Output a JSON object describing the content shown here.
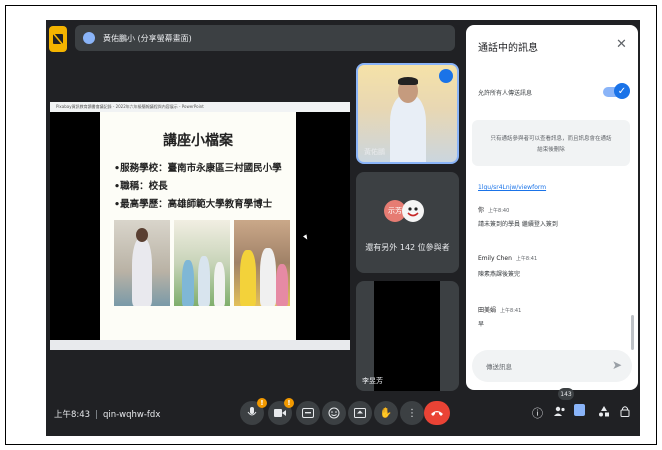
{
  "header": {
    "presenting_text": "黃佑鵬小 (分享螢幕畫面)"
  },
  "shared_screen": {
    "window_title": "Pixabay資訊教育讀書會議記錄 - 2022年六年級簡報議程與內容展示 - PowerPoint",
    "slide": {
      "title": "講座小檔案",
      "lines": [
        "•服務學校：臺南市永康區三村國民小學",
        "•職稱：校長",
        "•最高學歷：高雄師範大學教育學博士"
      ]
    }
  },
  "tiles": {
    "main_name": "黃佑鵬",
    "avatar_label": "示芳",
    "others_text": "還有另外 142 位參與者",
    "self_name": "李昱芳"
  },
  "chat": {
    "title": "通話中的訊息",
    "close_icon": "✕",
    "allow_label": "允許所有人傳送訊息",
    "notice_lines": [
      "只有通話參與者可以查看訊息，而且訊息會在通話",
      "結束後刪除"
    ],
    "link": "1lgu/sr4Lnjw/viewform",
    "messages": [
      {
        "sender": "你",
        "time": "上午8:40",
        "text": "請未簽到的學員 繼續登入簽到"
      },
      {
        "sender": "Emily Chen",
        "time": "上午8:41",
        "text": "陳素燕課後簽完"
      },
      {
        "sender": "田美娟",
        "time": "上午8:41",
        "text": "早"
      }
    ],
    "input_placeholder": "傳送訊息"
  },
  "bottom": {
    "time": "上午8:43",
    "meeting_code": "qin-wqhw-fdx",
    "participant_count": "143"
  },
  "colors": {
    "meet_bg": "#202124",
    "tile_bg": "#3c4043",
    "accent": "#1a73e8",
    "end_call": "#ea4335",
    "warning": "#f29900"
  }
}
